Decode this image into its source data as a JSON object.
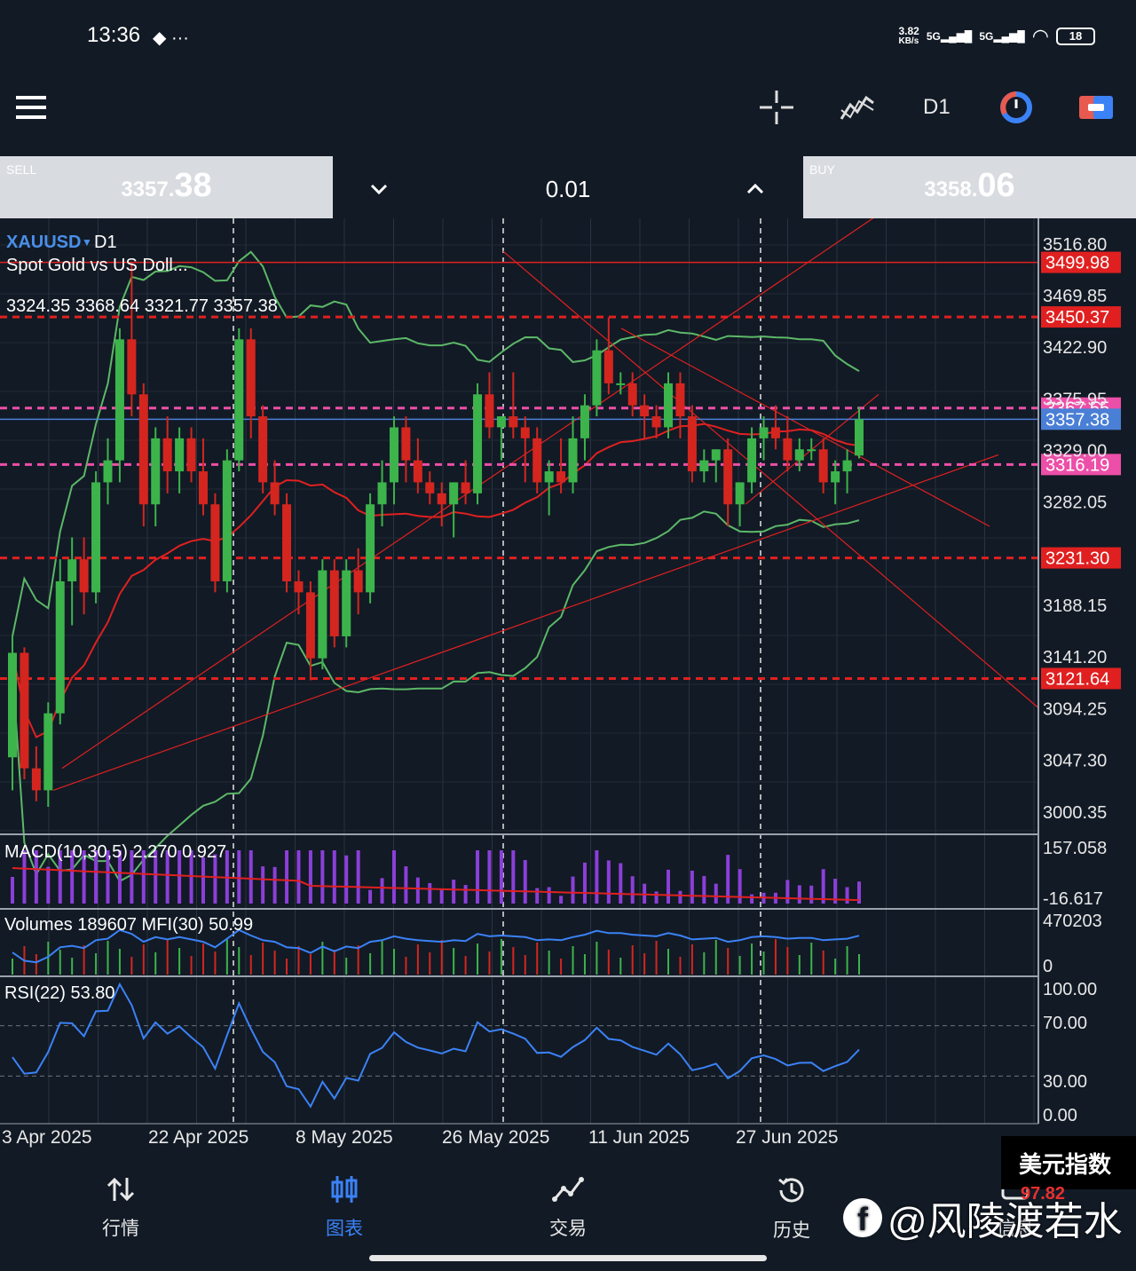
{
  "status": {
    "time": "13:36",
    "net_speed": "3.82",
    "net_unit": "KB/s",
    "signal1": "5G",
    "signal2": "5G",
    "battery": "18"
  },
  "toolbar": {
    "timeframe": "D1"
  },
  "trade": {
    "sell_label": "SELL",
    "sell_main": "3357.",
    "sell_big": "38",
    "lot": "0.01",
    "buy_label": "BUY",
    "buy_main": "3358.",
    "buy_big": "06"
  },
  "chart": {
    "symbol": "XAUUSD",
    "timeframe": "D1",
    "description": "Spot Gold vs US Doll...",
    "ohlc": "3324.35 3368.64 3321.77 3357.38",
    "price_axis": [
      "3516.80",
      "3469.85",
      "3422.90",
      "3375.95",
      "3329.00",
      "3282.05",
      "3188.15",
      "3141.20",
      "3094.25",
      "3047.30",
      "3000.35"
    ],
    "price_min": 2980,
    "price_max": 3540,
    "level_labels": [
      {
        "text": "3499.98",
        "price": 3499.98,
        "color": "#e02020",
        "style": "solid"
      },
      {
        "text": "3450.37",
        "price": 3450.37,
        "color": "#e02020",
        "style": "dashed"
      },
      {
        "text": "3367.55",
        "price": 3367.55,
        "color": "#ec4fa8",
        "style": "dashed"
      },
      {
        "text": "3357.38",
        "price": 3357.38,
        "color": "#4a7fd6",
        "style": "solid"
      },
      {
        "text": "3316.19",
        "price": 3316.19,
        "color": "#ec4fa8",
        "style": "dashed"
      },
      {
        "text": "3231.30",
        "price": 3231.3,
        "color": "#e02020",
        "style": "dashed"
      },
      {
        "text": "3121.64",
        "price": 3121.64,
        "color": "#e02020",
        "style": "dashed"
      }
    ],
    "date_labels": [
      "3 Apr 2025",
      "22 Apr 2025",
      "8 May 2025",
      "26 May 2025",
      "11 Jun 2025",
      "27 Jun 2025"
    ],
    "candles": [
      [
        3050,
        3160,
        3020,
        3145
      ],
      [
        3145,
        3150,
        3030,
        3040
      ],
      [
        3040,
        3060,
        3010,
        3020
      ],
      [
        3020,
        3100,
        3005,
        3090
      ],
      [
        3090,
        3230,
        3080,
        3210
      ],
      [
        3210,
        3250,
        3170,
        3230
      ],
      [
        3230,
        3250,
        3180,
        3200
      ],
      [
        3200,
        3310,
        3190,
        3300
      ],
      [
        3300,
        3340,
        3280,
        3320
      ],
      [
        3320,
        3440,
        3300,
        3430
      ],
      [
        3430,
        3500,
        3360,
        3380
      ],
      [
        3380,
        3390,
        3260,
        3280
      ],
      [
        3280,
        3350,
        3260,
        3340
      ],
      [
        3340,
        3360,
        3290,
        3310
      ],
      [
        3310,
        3350,
        3290,
        3340
      ],
      [
        3340,
        3350,
        3300,
        3310
      ],
      [
        3310,
        3340,
        3270,
        3280
      ],
      [
        3280,
        3290,
        3200,
        3210
      ],
      [
        3210,
        3330,
        3200,
        3320
      ],
      [
        3320,
        3440,
        3310,
        3430
      ],
      [
        3430,
        3440,
        3340,
        3360
      ],
      [
        3360,
        3370,
        3290,
        3300
      ],
      [
        3300,
        3320,
        3270,
        3280
      ],
      [
        3280,
        3290,
        3200,
        3210
      ],
      [
        3210,
        3220,
        3180,
        3200
      ],
      [
        3200,
        3210,
        3120,
        3140
      ],
      [
        3140,
        3230,
        3130,
        3220
      ],
      [
        3220,
        3230,
        3150,
        3160
      ],
      [
        3160,
        3230,
        3150,
        3220
      ],
      [
        3220,
        3240,
        3180,
        3200
      ],
      [
        3200,
        3290,
        3190,
        3280
      ],
      [
        3280,
        3320,
        3260,
        3300
      ],
      [
        3300,
        3360,
        3280,
        3350
      ],
      [
        3350,
        3360,
        3300,
        3320
      ],
      [
        3320,
        3340,
        3290,
        3300
      ],
      [
        3300,
        3310,
        3280,
        3290
      ],
      [
        3290,
        3300,
        3260,
        3280
      ],
      [
        3280,
        3300,
        3250,
        3300
      ],
      [
        3300,
        3320,
        3280,
        3290
      ],
      [
        3290,
        3390,
        3280,
        3380
      ],
      [
        3380,
        3400,
        3340,
        3350
      ],
      [
        3350,
        3360,
        3320,
        3360
      ],
      [
        3360,
        3400,
        3340,
        3350
      ],
      [
        3350,
        3360,
        3300,
        3340
      ],
      [
        3340,
        3350,
        3290,
        3300
      ],
      [
        3300,
        3320,
        3270,
        3310
      ],
      [
        3310,
        3340,
        3290,
        3300
      ],
      [
        3300,
        3360,
        3290,
        3340
      ],
      [
        3340,
        3380,
        3320,
        3370
      ],
      [
        3370,
        3430,
        3360,
        3420
      ],
      [
        3420,
        3450,
        3380,
        3390
      ],
      [
        3390,
        3400,
        3380,
        3390
      ],
      [
        3390,
        3400,
        3360,
        3370
      ],
      [
        3370,
        3380,
        3340,
        3360
      ],
      [
        3360,
        3370,
        3340,
        3350
      ],
      [
        3350,
        3400,
        3340,
        3390
      ],
      [
        3390,
        3400,
        3340,
        3360
      ],
      [
        3360,
        3370,
        3300,
        3310
      ],
      [
        3310,
        3330,
        3300,
        3320
      ],
      [
        3320,
        3330,
        3300,
        3330
      ],
      [
        3330,
        3340,
        3260,
        3280
      ],
      [
        3280,
        3300,
        3260,
        3300
      ],
      [
        3300,
        3350,
        3290,
        3340
      ],
      [
        3340,
        3360,
        3320,
        3350
      ],
      [
        3350,
        3370,
        3330,
        3340
      ],
      [
        3340,
        3360,
        3310,
        3320
      ],
      [
        3320,
        3340,
        3310,
        3330
      ],
      [
        3330,
        3340,
        3320,
        3330
      ],
      [
        3330,
        3340,
        3290,
        3300
      ],
      [
        3300,
        3320,
        3280,
        3310
      ],
      [
        3310,
        3330,
        3290,
        3320
      ],
      [
        3324.35,
        3368.64,
        3321.77,
        3357.38
      ]
    ],
    "macd_label": "MACD(10,30,5) 2.270 0.927",
    "macd_axis": [
      "157.058",
      "-16.617"
    ],
    "volumes_label": "Volumes 189607 MFI(30) 50.99",
    "volumes_axis": [
      "470203",
      "0"
    ],
    "rsi_label": "RSI(22) 53.80",
    "rsi_axis": [
      "100.00",
      "70.00",
      "30.00",
      "0.00"
    ]
  },
  "nav": {
    "items": [
      {
        "label": "行情",
        "icon": "quotes-icon"
      },
      {
        "label": "图表",
        "icon": "chart-icon"
      },
      {
        "label": "交易",
        "icon": "trade-icon"
      },
      {
        "label": "历史",
        "icon": "history-icon"
      },
      {
        "label": "信息",
        "icon": "messages-icon"
      }
    ]
  },
  "overlay": {
    "usd_index_title": "美元指数",
    "usd_index_value": "97.82",
    "watermark": "@风陵渡若水"
  }
}
